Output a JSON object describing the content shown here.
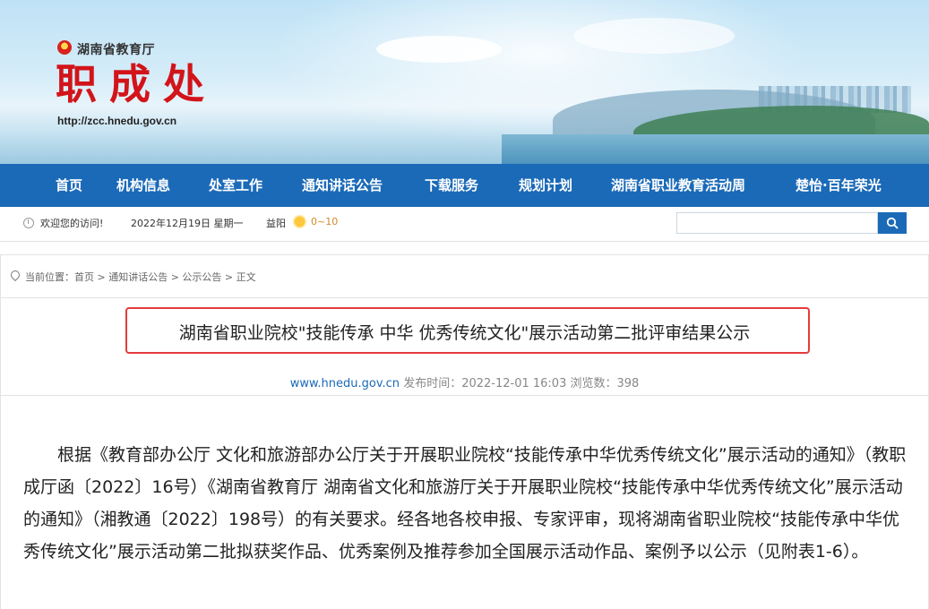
{
  "header": {
    "dept_name": "湖南省教育厅",
    "site_title": "职成处",
    "site_url": "http://zcc.hnedu.gov.cn"
  },
  "nav": {
    "items": [
      {
        "label": "首页"
      },
      {
        "label": "机构信息"
      },
      {
        "label": "处室工作"
      },
      {
        "label": "通知讲话公告"
      },
      {
        "label": "下载服务"
      },
      {
        "label": "规划计划"
      },
      {
        "label": "湖南省职业教育活动周"
      },
      {
        "label": "楚怡·百年荣光"
      }
    ]
  },
  "infobar": {
    "welcome": "欢迎您的访问!",
    "date": "2022年12月19日 星期一",
    "city": "益阳",
    "temp": "0~10",
    "weather_icon": "sunny-icon"
  },
  "search": {
    "placeholder": ""
  },
  "breadcrumb": {
    "text": "当前位置：首页 > 通知讲话公告 > 公示公告 > 正文"
  },
  "article": {
    "title": "湖南省职业院校\"技能传承 中华 优秀传统文化\"展示活动第二批评审结果公示",
    "source": "www.hnedu.gov.cn",
    "meta": " 发布时间：2022-12-01 16:03 浏览数：398",
    "body": "根据《教育部办公厅 文化和旅游部办公厅关于开展职业院校“技能传承中华优秀传统文化”展示活动的通知》（教职成厅函〔2022〕16号）《湖南省教育厅 湖南省文化和旅游厅关于开展职业院校“技能传承中华优秀传统文化”展示活动的通知》（湘教通〔2022〕198号）的有关要求。经各地各校申报、专家评审，现将湖南省职业院校“技能传承中华优秀传统文化”展示活动第二批拟获奖作品、优秀案例及推荐参加全国展示活动作品、案例予以公示（见附表1-6）。"
  },
  "colors": {
    "nav_bg": "#1b6ab8",
    "logo_red": "#d2141a",
    "highlight_border": "#e53b3b"
  }
}
